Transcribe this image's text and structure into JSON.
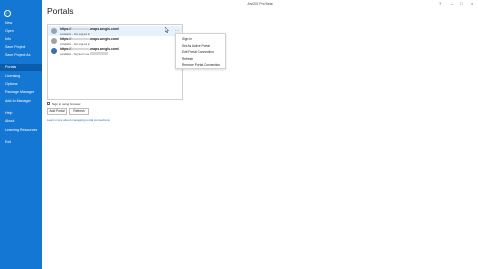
{
  "app": {
    "title": "ArcGIS Pro Beta",
    "help_label": "?",
    "minimize_label": "–",
    "maximize_label": "□",
    "close_label": "×"
  },
  "sidebar": {
    "back_label": "←",
    "items": [
      {
        "label": "New",
        "active": false
      },
      {
        "label": "Open",
        "active": false
      },
      {
        "label": "Info",
        "active": false
      },
      {
        "label": "Save Project",
        "active": false
      },
      {
        "label": "Save Project As",
        "active": false
      },
      {
        "label": "Portals",
        "active": true
      },
      {
        "label": "Licensing",
        "active": false
      },
      {
        "label": "Options",
        "active": false
      },
      {
        "label": "Package Manager",
        "active": false
      },
      {
        "label": "Add-In Manager",
        "active": false
      },
      {
        "label": "Help",
        "active": false
      },
      {
        "label": "About",
        "active": false
      },
      {
        "label": "Learning Resources",
        "active": false
      },
      {
        "label": "Exit",
        "active": false
      }
    ]
  },
  "page": {
    "title": "Portals"
  },
  "portals": [
    {
      "url_prefix": "https://",
      "url_suffix": ".maps.arcgis.com/",
      "status": "Available - Not signed in",
      "selected": true,
      "active": false
    },
    {
      "url_prefix": "https://",
      "url_suffix": ".maps.arcgis.com/",
      "status": "Available - Not signed in",
      "selected": false,
      "active": false
    },
    {
      "url_prefix": "https://",
      "url_suffix": ".maps.arcgis.com/",
      "status_prefix": "Available - Signed in as",
      "selected": false,
      "active": true
    }
  ],
  "more_label": "···",
  "context_menu": {
    "items": [
      "Sign in",
      "Set As Active Portal",
      "Edit Portal Connection",
      "Refresh",
      "Remove Portal Connection"
    ]
  },
  "sign_in_checkbox_label": "Sign in using browser",
  "buttons": {
    "add_portal": "Add Portal",
    "refresh": "Refresh"
  },
  "learn_link": "Learn more about managing portal connections"
}
